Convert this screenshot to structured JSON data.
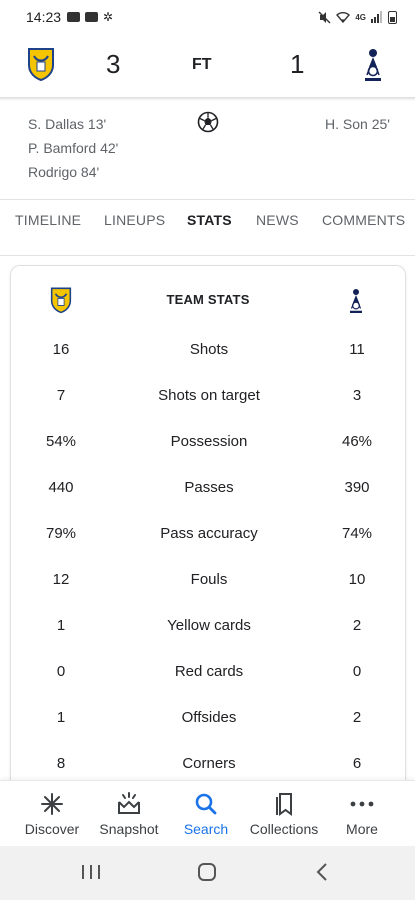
{
  "status_bar": {
    "time": "14:23"
  },
  "match": {
    "home_team_icon": "leeds-crest-icon",
    "away_team_icon": "tottenham-crest-icon",
    "home_score": "3",
    "away_score": "1",
    "status": "FT",
    "home_scorers": [
      "S. Dallas 13'",
      "P. Bamford 42'",
      "Rodrigo 84'"
    ],
    "away_scorers": [
      "H. Son 25'"
    ]
  },
  "tabs": [
    {
      "label": "TIMELINE",
      "active": false
    },
    {
      "label": "LINEUPS",
      "active": false
    },
    {
      "label": "STATS",
      "active": true
    },
    {
      "label": "NEWS",
      "active": false
    },
    {
      "label": "COMMENTS",
      "active": false
    }
  ],
  "team_stats": {
    "title": "TEAM STATS",
    "rows": [
      {
        "label": "Shots",
        "home": "16",
        "away": "11"
      },
      {
        "label": "Shots on target",
        "home": "7",
        "away": "3"
      },
      {
        "label": "Possession",
        "home": "54%",
        "away": "46%"
      },
      {
        "label": "Passes",
        "home": "440",
        "away": "390"
      },
      {
        "label": "Pass accuracy",
        "home": "79%",
        "away": "74%"
      },
      {
        "label": "Fouls",
        "home": "12",
        "away": "10"
      },
      {
        "label": "Yellow cards",
        "home": "1",
        "away": "2"
      },
      {
        "label": "Red cards",
        "home": "0",
        "away": "0"
      },
      {
        "label": "Offsides",
        "home": "1",
        "away": "2"
      },
      {
        "label": "Corners",
        "home": "8",
        "away": "6"
      }
    ]
  },
  "bottom_nav": [
    {
      "label": "Discover",
      "icon": "asterisk-icon",
      "active": false
    },
    {
      "label": "Snapshot",
      "icon": "snapshot-icon",
      "active": false
    },
    {
      "label": "Search",
      "icon": "search-icon",
      "active": true
    },
    {
      "label": "Collections",
      "icon": "bookmark-icon",
      "active": false
    },
    {
      "label": "More",
      "icon": "more-dots-icon",
      "active": false
    }
  ],
  "colors": {
    "accent": "#1a73e8",
    "leeds_yellow": "#f5c400",
    "leeds_blue": "#1d428a",
    "spurs_navy": "#132257"
  }
}
